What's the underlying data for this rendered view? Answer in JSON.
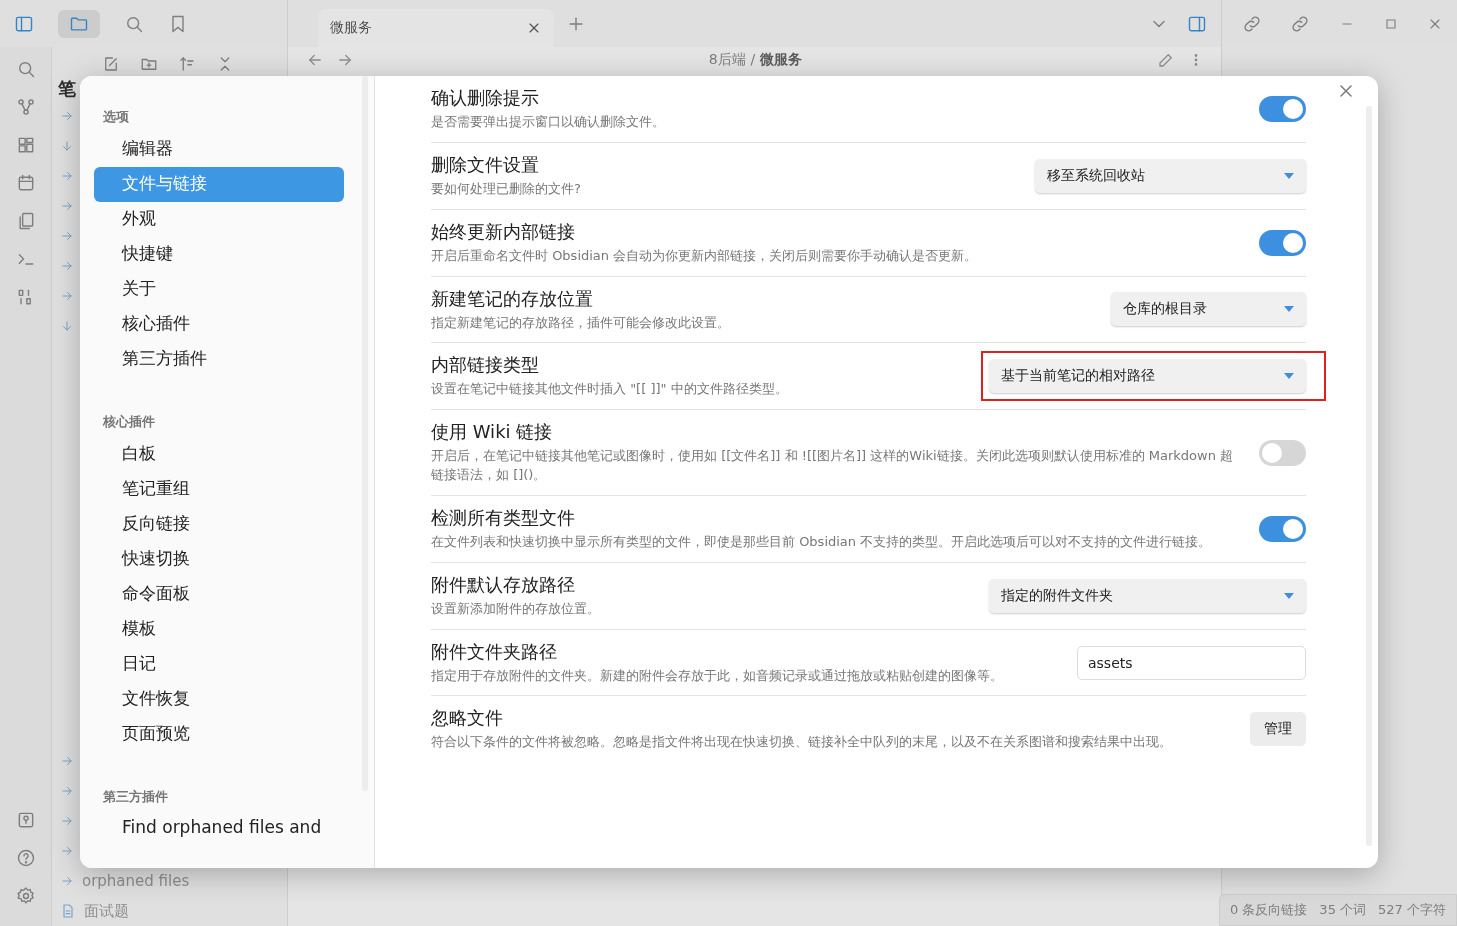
{
  "titlebar": {
    "tabs": [
      {
        "label": "微服务",
        "selected": true
      }
    ]
  },
  "breadcrumb": {
    "folder": "8后端",
    "separator": "/",
    "note": "微服务"
  },
  "file_pane": {
    "heading": "笔",
    "top_items": [
      {
        "expanded": false
      },
      {
        "expanded": true
      },
      {
        "expanded": false
      },
      {
        "expanded": false
      },
      {
        "expanded": false
      },
      {
        "expanded": false
      },
      {
        "expanded": false
      },
      {
        "expanded": true
      }
    ],
    "bottom_items": [
      {
        "kind": "folder",
        "expanded": false
      },
      {
        "kind": "folder",
        "expanded": false
      },
      {
        "kind": "folder",
        "expanded": false
      },
      {
        "kind": "folder",
        "expanded": false
      },
      {
        "kind": "folder",
        "expanded": false,
        "label": "orphaned files"
      },
      {
        "kind": "file",
        "label": "面试题"
      }
    ]
  },
  "status_bar": [
    "0 条反向链接",
    "35 个词",
    "527 个字符"
  ],
  "settings_dialog": {
    "nav": [
      {
        "heading": "选项",
        "items": [
          {
            "label": "编辑器",
            "selected": false
          },
          {
            "label": "文件与链接",
            "selected": true
          },
          {
            "label": "外观",
            "selected": false
          },
          {
            "label": "快捷键",
            "selected": false
          },
          {
            "label": "关于",
            "selected": false
          },
          {
            "label": "核心插件",
            "selected": false
          },
          {
            "label": "第三方插件",
            "selected": false
          }
        ]
      },
      {
        "heading": "核心插件",
        "items": [
          {
            "label": "白板",
            "selected": false
          },
          {
            "label": "笔记重组",
            "selected": false
          },
          {
            "label": "反向链接",
            "selected": false
          },
          {
            "label": "快速切换",
            "selected": false
          },
          {
            "label": "命令面板",
            "selected": false
          },
          {
            "label": "模板",
            "selected": false
          },
          {
            "label": "日记",
            "selected": false
          },
          {
            "label": "文件恢复",
            "selected": false
          },
          {
            "label": "页面预览",
            "selected": false
          }
        ]
      },
      {
        "heading": "第三方插件",
        "items": [
          {
            "label": "Find orphaned files and",
            "selected": false
          }
        ]
      }
    ],
    "settings": [
      {
        "name": "确认删除提示",
        "description": "是否需要弹出提示窗口以确认删除文件。",
        "kind": "toggle",
        "on": true
      },
      {
        "name": "删除文件设置",
        "description": "要如何处理已删除的文件?",
        "kind": "dropdown",
        "value": "移至系统回收站"
      },
      {
        "name": "始终更新内部链接",
        "description": "开启后重命名文件时 Obsidian 会自动为你更新内部链接，关闭后则需要你手动确认是否更新。",
        "kind": "toggle",
        "on": true
      },
      {
        "name": "新建笔记的存放位置",
        "description": "指定新建笔记的存放路径，插件可能会修改此设置。",
        "kind": "dropdown",
        "value": "仓库的根目录"
      },
      {
        "name": "内部链接类型",
        "description": "设置在笔记中链接其他文件时插入 \"[[ ]]\" 中的文件路径类型。",
        "kind": "dropdown",
        "value": "基于当前笔记的相对路径",
        "highlighted": true
      },
      {
        "name": "使用 Wiki 链接",
        "description": "开启后，在笔记中链接其他笔记或图像时，使用如 [[文件名]] 和 ![[图片名]] 这样的Wiki链接。关闭此选项则默认使用标准的 Markdown 超链接语法，如 []()。",
        "kind": "toggle",
        "on": false
      },
      {
        "name": "检测所有类型文件",
        "description": "在文件列表和快速切换中显示所有类型的文件，即使是那些目前 Obsidian 不支持的类型。开启此选项后可以对不支持的文件进行链接。",
        "kind": "toggle",
        "on": true
      },
      {
        "name": "附件默认存放路径",
        "description": "设置新添加附件的存放位置。",
        "kind": "dropdown",
        "value": "指定的附件文件夹"
      },
      {
        "name": "附件文件夹路径",
        "description": "指定用于存放附件的文件夹。新建的附件会存放于此，如音频记录或通过拖放或粘贴创建的图像等。",
        "kind": "text",
        "value": "assets"
      },
      {
        "name": "忽略文件",
        "description": "符合以下条件的文件将被忽略。忽略是指文件将出现在快速切换、链接补全中队列的末尾，以及不在关系图谱和搜索结果中出现。",
        "kind": "button",
        "label": "管理"
      }
    ]
  }
}
